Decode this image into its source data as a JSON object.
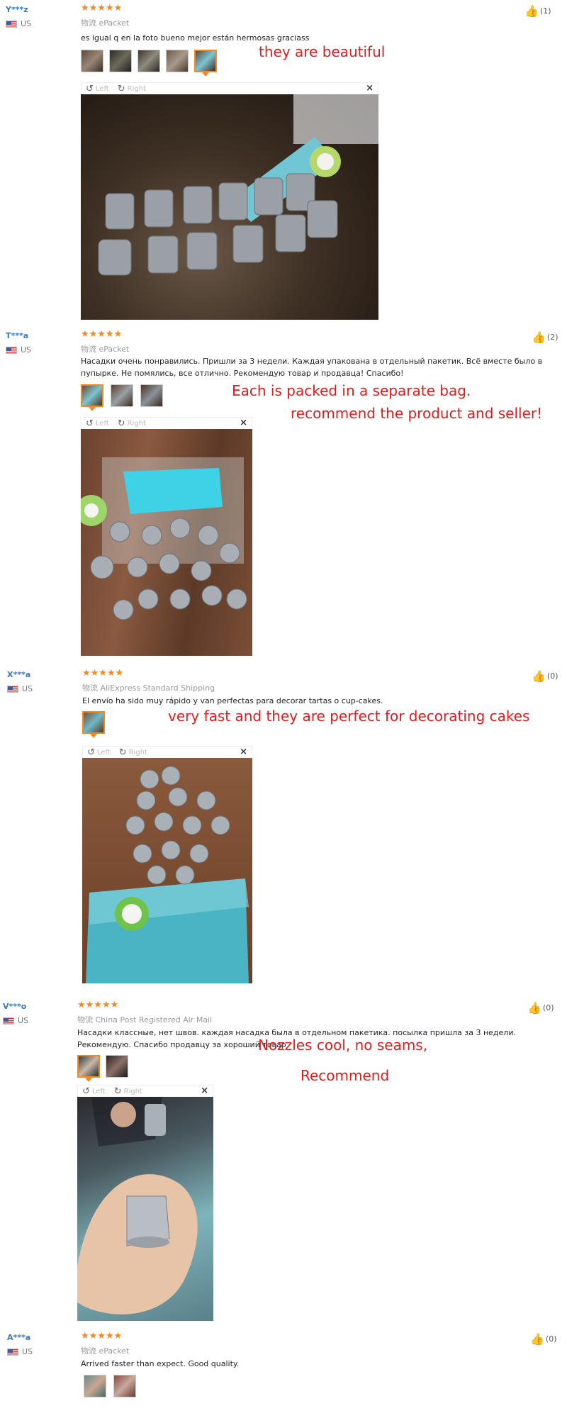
{
  "viewer": {
    "left_label": "Left",
    "right_label": "Right",
    "rotate_left_icon": "↺",
    "rotate_right_icon": "↻",
    "close_icon": "×"
  },
  "reviews": [
    {
      "user": "Y***z",
      "country": "US",
      "stars": "★★★★★",
      "shipping": "物流 ePacket",
      "comment": "es igual q en la foto bueno mejor están hermosas graciass",
      "helpful": "(1)",
      "annotations": [
        "they are beautiful"
      ],
      "thumb_count": 5,
      "active_thumb": 5
    },
    {
      "user": "T***a",
      "country": "US",
      "stars": "★★★★★",
      "shipping": "物流 ePacket",
      "comment": "Насадки очень понравились. Пришли за 3 недели. Каждая упакована в отдельный пакетик. Всё вместе было в пупырке. Не помялись, все отлично. Рекомендую товар и продавца! Спасибо!",
      "helpful": "(2)",
      "annotations": [
        "Each is packed in a separate bag.",
        "recommend the product and seller!"
      ],
      "thumb_count": 3,
      "active_thumb": 1
    },
    {
      "user": "X***a",
      "country": "US",
      "stars": "★★★★★",
      "shipping": "物流 AliExpress Standard Shipping",
      "comment": "El envío ha sido muy rápido y van perfectas para decorar tartas o cup-cakes.",
      "helpful": "(0)",
      "annotations": [
        "very fast and they are perfect for decorating cakes"
      ],
      "thumb_count": 1,
      "active_thumb": 1
    },
    {
      "user": "V***o",
      "country": "US",
      "stars": "★★★★★",
      "shipping": "物流 China Post Registered Air Mail",
      "comment": "Насадки классные, нет швов. каждая насадка была в отдельном пакетика. посылка пришла за 3 недели. Рекомендую. Спасибо продавцу за хороший товар",
      "helpful": "(0)",
      "annotations": [
        "Nozzles cool, no seams,",
        "Recommend"
      ],
      "thumb_count": 2,
      "active_thumb": 1
    },
    {
      "user": "A***a",
      "country": "US",
      "stars": "★★★★★",
      "shipping": "物流 ePacket",
      "comment": "Arrived faster than expect. Good quality.",
      "helpful": "(0)",
      "annotations": [],
      "thumb_count": 2,
      "active_thumb": 0
    }
  ],
  "icons": {
    "like": "thumbs-up-icon",
    "flag": "us-flag-icon"
  },
  "colors": {
    "username": "#3a78c3",
    "stars": "#f08a24",
    "annotation": "#d81e1e"
  }
}
